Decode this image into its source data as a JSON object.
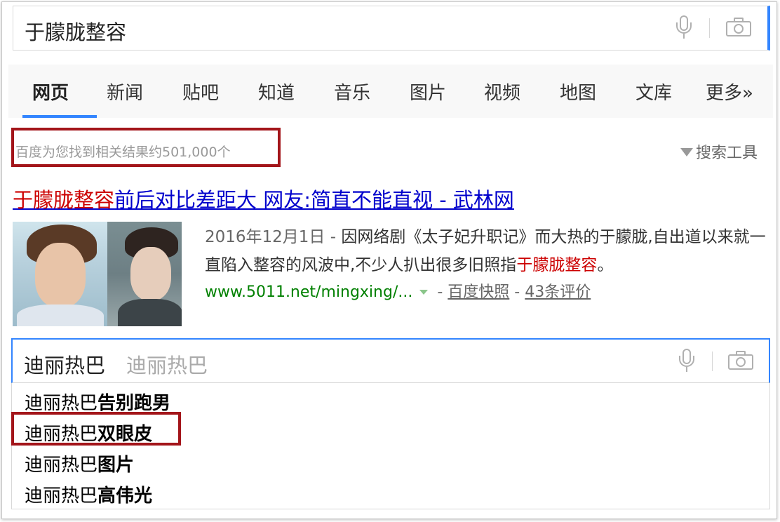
{
  "top_search": {
    "query": "于朦胧整容",
    "icons": [
      "microphone-icon",
      "camera-icon"
    ]
  },
  "tabs": [
    {
      "label": "网页",
      "active": true
    },
    {
      "label": "新闻"
    },
    {
      "label": "贴吧"
    },
    {
      "label": "知道"
    },
    {
      "label": "音乐"
    },
    {
      "label": "图片"
    },
    {
      "label": "视频"
    },
    {
      "label": "地图"
    },
    {
      "label": "文库"
    },
    {
      "label": "更多»"
    }
  ],
  "result_count": "百度为您找到相关结果约501,000个",
  "search_tools": "搜索工具",
  "result": {
    "title_em": "于朦胧整容",
    "title_rest": "前后对比差距大 网友:简直不能直视 - 武林网",
    "snippet_date": "2016年12月1日 - ",
    "snippet_part1": "因网络剧《太子妃升职记》而大热的于朦胧,自出道以来就一直陷入整容的风波中,不少人扒出很多旧照指",
    "snippet_em": "于朦胧整容",
    "snippet_end": "。",
    "url": "www.5011.net/mingxing/...",
    "sep1": " - ",
    "cache_link": "百度快照",
    "sep2": " - ",
    "reviews_link": "43条评价"
  },
  "second_search": {
    "query": "迪丽热巴",
    "hint": "迪丽热巴"
  },
  "suggestions": [
    {
      "prefix": "迪丽热巴",
      "suffix": "告别跑男"
    },
    {
      "prefix": "迪丽热巴",
      "suffix": "双眼皮",
      "highlighted": true
    },
    {
      "prefix": "迪丽热巴",
      "suffix": "图片"
    },
    {
      "prefix": "迪丽热巴",
      "suffix": "高伟光"
    }
  ],
  "colors": {
    "accent": "#3385ff",
    "highlight_box": "#a3151a",
    "link": "#0000cc",
    "em": "#cc0000",
    "url": "#008000"
  }
}
